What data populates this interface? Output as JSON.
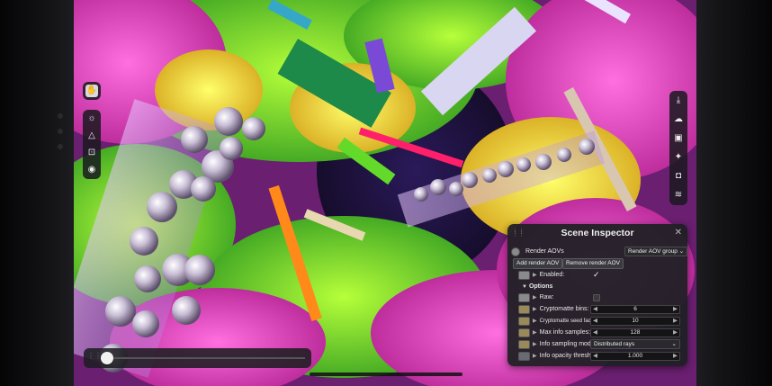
{
  "toolbar_left": {
    "items": [
      {
        "icon": "hand-icon",
        "active": true
      },
      {
        "icon": "sun-icon",
        "active": false
      },
      {
        "icon": "triangle-icon",
        "active": false
      },
      {
        "icon": "target-icon",
        "active": false
      },
      {
        "icon": "eye-icon",
        "active": false
      }
    ]
  },
  "toolbar_right": {
    "items": [
      {
        "icon": "download-icon"
      },
      {
        "icon": "weather-icon"
      },
      {
        "icon": "image-icon"
      },
      {
        "icon": "sparkle-icon"
      },
      {
        "icon": "camera-icon"
      },
      {
        "icon": "layers-icon"
      }
    ]
  },
  "timeline_slider": {
    "value": 0.0
  },
  "inspector": {
    "title": "Scene Inspector",
    "close_glyph": "✕",
    "render_aovs_label": "Render AOVs",
    "group_dropdown": "Render AOV group",
    "add_button": "Add render AOV",
    "remove_button": "Remove render AOV",
    "enabled_label": "Enabled:",
    "enabled_mark": "✓",
    "options_label": "Options",
    "options_arrow": "▼",
    "raw_label": "Raw:",
    "fields": [
      {
        "label": "Cryptomatte bins:",
        "value": "6"
      },
      {
        "label": "Cryptomatte seed factor:",
        "value": "10"
      },
      {
        "label": "Max info samples:",
        "value": "128"
      }
    ],
    "sampling_label": "Info sampling mode:",
    "sampling_value": "Distributed rays",
    "threshold_label": "Info opacity threshold:",
    "threshold_value": "1.000",
    "dec_glyph": "◀",
    "inc_glyph": "▶",
    "row_arrow": "▶",
    "dropdown_arrow": "⌄"
  },
  "colors": {
    "panel_bg": "#202024",
    "accent": "#f0f0f0"
  }
}
